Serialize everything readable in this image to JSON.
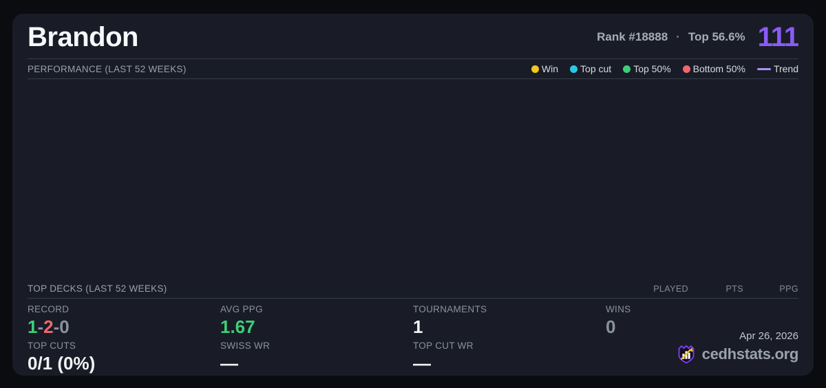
{
  "colors": {
    "page_bg": "#0b0c10",
    "card_bg": "#191c26",
    "accent_purple": "#8b5cf6",
    "green": "#3ecf78",
    "red": "#ef686e",
    "gray_value": "#8b919e",
    "white_value": "#f2f3f5",
    "logo_purple": "#7c3aed",
    "logo_gold": "#f2c71e"
  },
  "header": {
    "title": "Brandon",
    "rank_label": "Rank #18888",
    "separator": "·",
    "top_percent": "Top 56.6%",
    "rating": "111"
  },
  "performance": {
    "title": "PERFORMANCE (LAST 52 WEEKS)",
    "legend": [
      {
        "label": "Win",
        "color": "#f2c71e",
        "swatch": "dot"
      },
      {
        "label": "Top cut",
        "color": "#2ac8e8",
        "swatch": "dot"
      },
      {
        "label": "Top 50%",
        "color": "#3ecf78",
        "swatch": "dot"
      },
      {
        "label": "Bottom 50%",
        "color": "#ef686e",
        "swatch": "dot"
      },
      {
        "label": "Trend",
        "color": "#ab92f8",
        "swatch": "line"
      }
    ]
  },
  "chart_data": {
    "type": "scatter",
    "title": "PERFORMANCE (LAST 52 WEEKS)",
    "legend_entries": [
      "Win",
      "Top cut",
      "Top 50%",
      "Bottom 50%",
      "Trend"
    ],
    "x": [],
    "series": [],
    "note": "chart plot area is rendered empty - no data points, axes or gridlines visible"
  },
  "top_decks": {
    "title": "TOP DECKS (LAST 52 WEEKS)",
    "columns": [
      "PLAYED",
      "PTS",
      "PPG"
    ],
    "rows": []
  },
  "stats": {
    "record": {
      "label": "RECORD",
      "wins": "1",
      "dash1": "-",
      "losses": "2",
      "dash2": "-",
      "draws": "0"
    },
    "avg_ppg": {
      "label": "AVG PPG",
      "value": "1.67"
    },
    "tournaments": {
      "label": "TOURNAMENTS",
      "value": "1"
    },
    "wins": {
      "label": "WINS",
      "value": "0"
    },
    "top_cuts": {
      "label": "TOP CUTS",
      "value": "0/1 (0%)"
    },
    "swiss_wr": {
      "label": "SWISS WR",
      "value": "—"
    },
    "top_cut_wr": {
      "label": "TOP CUT WR",
      "value": "—"
    }
  },
  "footer": {
    "date": "Apr 26, 2026",
    "brand": "cedhstats.org",
    "logo": "shield-barchart-arrow"
  }
}
